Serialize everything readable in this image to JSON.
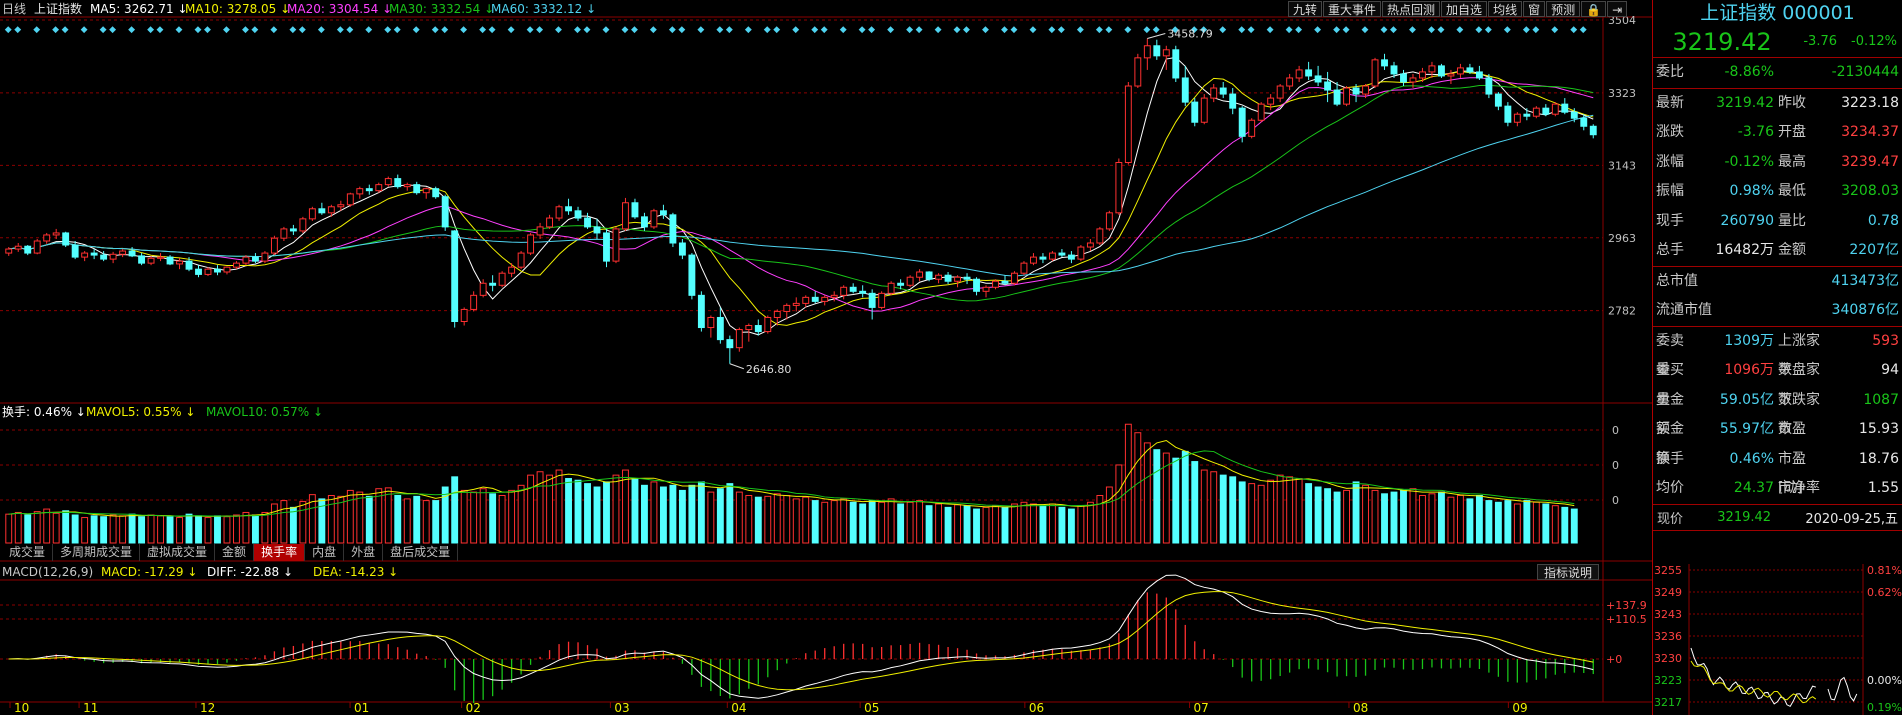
{
  "chart_data": {
    "type": "candlestick",
    "title": "上证指数",
    "period": "日线",
    "price_axis": {
      "min": 2560,
      "max": 3504,
      "ticks": [
        "3504",
        "3323",
        "3143",
        "2963",
        "2782"
      ]
    },
    "month_labels": [
      "10",
      "11",
      "12",
      "01",
      "02",
      "03",
      "04",
      "05",
      "06",
      "07",
      "08",
      "09"
    ],
    "candles": [
      [
        2925,
        2940,
        2918,
        2935
      ],
      [
        2935,
        2950,
        2928,
        2942
      ],
      [
        2942,
        2945,
        2920,
        2925
      ],
      [
        2925,
        2960,
        2922,
        2955
      ],
      [
        2955,
        2975,
        2948,
        2970
      ],
      [
        2970,
        2985,
        2960,
        2975
      ],
      [
        2975,
        2978,
        2940,
        2945
      ],
      [
        2945,
        2955,
        2910,
        2915
      ],
      [
        2915,
        2930,
        2905,
        2925
      ],
      [
        2925,
        2935,
        2910,
        2920
      ],
      [
        2920,
        2930,
        2905,
        2910
      ],
      [
        2910,
        2928,
        2900,
        2922
      ],
      [
        2922,
        2935,
        2915,
        2930
      ],
      [
        2930,
        2940,
        2915,
        2918
      ],
      [
        2918,
        2925,
        2895,
        2900
      ],
      [
        2900,
        2918,
        2895,
        2912
      ],
      [
        2912,
        2925,
        2905,
        2915
      ],
      [
        2915,
        2920,
        2895,
        2898
      ],
      [
        2898,
        2912,
        2885,
        2905
      ],
      [
        2905,
        2915,
        2880,
        2885
      ],
      [
        2885,
        2895,
        2865,
        2872
      ],
      [
        2872,
        2890,
        2868,
        2885
      ],
      [
        2885,
        2895,
        2870,
        2878
      ],
      [
        2878,
        2892,
        2872,
        2890
      ],
      [
        2890,
        2905,
        2885,
        2900
      ],
      [
        2900,
        2920,
        2895,
        2915
      ],
      [
        2915,
        2925,
        2900,
        2905
      ],
      [
        2905,
        2930,
        2900,
        2925
      ],
      [
        2925,
        2968,
        2920,
        2962
      ],
      [
        2962,
        2990,
        2955,
        2985
      ],
      [
        2985,
        2995,
        2970,
        2980
      ],
      [
        2980,
        3015,
        2975,
        3010
      ],
      [
        3010,
        3040,
        3005,
        3035
      ],
      [
        3035,
        3050,
        3020,
        3025
      ],
      [
        3025,
        3045,
        3015,
        3040
      ],
      [
        3040,
        3055,
        3030,
        3045
      ],
      [
        3045,
        3075,
        3040,
        3072
      ],
      [
        3072,
        3090,
        3060,
        3085
      ],
      [
        3085,
        3095,
        3070,
        3080
      ],
      [
        3080,
        3100,
        3075,
        3095
      ],
      [
        3095,
        3115,
        3090,
        3110
      ],
      [
        3110,
        3120,
        3085,
        3090
      ],
      [
        3090,
        3100,
        3080,
        3095
      ],
      [
        3095,
        3102,
        3070,
        3075
      ],
      [
        3075,
        3088,
        3060,
        3085
      ],
      [
        3085,
        3090,
        3060,
        3065
      ],
      [
        3065,
        3070,
        2980,
        2990
      ],
      [
        2980,
        2982,
        2740,
        2755
      ],
      [
        2755,
        2790,
        2745,
        2785
      ],
      [
        2785,
        2830,
        2780,
        2820
      ],
      [
        2820,
        2860,
        2815,
        2850
      ],
      [
        2850,
        2870,
        2830,
        2845
      ],
      [
        2845,
        2880,
        2840,
        2875
      ],
      [
        2875,
        2900,
        2865,
        2890
      ],
      [
        2890,
        2930,
        2885,
        2925
      ],
      [
        2925,
        2975,
        2920,
        2970
      ],
      [
        2970,
        3000,
        2960,
        2990
      ],
      [
        2990,
        3020,
        2985,
        3012
      ],
      [
        3012,
        3045,
        3005,
        3040
      ],
      [
        3040,
        3060,
        3020,
        3030
      ],
      [
        3030,
        3040,
        3005,
        3012
      ],
      [
        3012,
        3025,
        2985,
        2990
      ],
      [
        2990,
        3010,
        2960,
        2975
      ],
      [
        2975,
        2985,
        2890,
        2905
      ],
      [
        2905,
        2990,
        2900,
        2985
      ],
      [
        2985,
        3062,
        2980,
        3050
      ],
      [
        3050,
        3060,
        3010,
        3015
      ],
      [
        3015,
        3025,
        2980,
        2990
      ],
      [
        2990,
        3035,
        2985,
        3030
      ],
      [
        3030,
        3045,
        3010,
        3020
      ],
      [
        3020,
        3025,
        2940,
        2950
      ],
      [
        2950,
        2960,
        2910,
        2920
      ],
      [
        2920,
        2925,
        2810,
        2820
      ],
      [
        2820,
        2830,
        2730,
        2740
      ],
      [
        2740,
        2770,
        2715,
        2765
      ],
      [
        2765,
        2790,
        2700,
        2710
      ],
      [
        2710,
        2720,
        2650,
        2690
      ],
      [
        2690,
        2740,
        2680,
        2735
      ],
      [
        2735,
        2750,
        2705,
        2745
      ],
      [
        2745,
        2760,
        2720,
        2730
      ],
      [
        2730,
        2770,
        2725,
        2765
      ],
      [
        2765,
        2785,
        2745,
        2780
      ],
      [
        2780,
        2800,
        2760,
        2795
      ],
      [
        2795,
        2815,
        2780,
        2800
      ],
      [
        2800,
        2820,
        2790,
        2815
      ],
      [
        2815,
        2830,
        2800,
        2805
      ],
      [
        2805,
        2820,
        2795,
        2815
      ],
      [
        2815,
        2830,
        2805,
        2820
      ],
      [
        2820,
        2845,
        2810,
        2840
      ],
      [
        2840,
        2850,
        2825,
        2830
      ],
      [
        2830,
        2845,
        2815,
        2825
      ],
      [
        2825,
        2835,
        2760,
        2790
      ],
      [
        2790,
        2830,
        2785,
        2825
      ],
      [
        2825,
        2855,
        2820,
        2850
      ],
      [
        2850,
        2860,
        2835,
        2845
      ],
      [
        2845,
        2870,
        2840,
        2865
      ],
      [
        2865,
        2885,
        2855,
        2878
      ],
      [
        2878,
        2880,
        2855,
        2860
      ],
      [
        2860,
        2875,
        2850,
        2870
      ],
      [
        2870,
        2878,
        2848,
        2855
      ],
      [
        2855,
        2870,
        2840,
        2865
      ],
      [
        2865,
        2875,
        2848,
        2860
      ],
      [
        2860,
        2865,
        2820,
        2830
      ],
      [
        2830,
        2845,
        2815,
        2840
      ],
      [
        2840,
        2860,
        2835,
        2855
      ],
      [
        2855,
        2870,
        2845,
        2850
      ],
      [
        2850,
        2880,
        2845,
        2875
      ],
      [
        2875,
        2905,
        2870,
        2900
      ],
      [
        2900,
        2925,
        2895,
        2915
      ],
      [
        2915,
        2925,
        2900,
        2910
      ],
      [
        2910,
        2930,
        2905,
        2925
      ],
      [
        2925,
        2935,
        2915,
        2920
      ],
      [
        2920,
        2930,
        2900,
        2910
      ],
      [
        2910,
        2945,
        2905,
        2940
      ],
      [
        2940,
        2960,
        2930,
        2950
      ],
      [
        2950,
        2990,
        2945,
        2985
      ],
      [
        2985,
        3030,
        2980,
        3025
      ],
      [
        3025,
        3160,
        3020,
        3150
      ],
      [
        3150,
        3350,
        3145,
        3340
      ],
      [
        3340,
        3420,
        3335,
        3410
      ],
      [
        3410,
        3458,
        3380,
        3440
      ],
      [
        3440,
        3455,
        3405,
        3415
      ],
      [
        3415,
        3440,
        3380,
        3430
      ],
      [
        3430,
        3440,
        3350,
        3360
      ],
      [
        3360,
        3390,
        3290,
        3300
      ],
      [
        3300,
        3310,
        3240,
        3250
      ],
      [
        3250,
        3320,
        3245,
        3310
      ],
      [
        3310,
        3345,
        3300,
        3335
      ],
      [
        3335,
        3350,
        3310,
        3320
      ],
      [
        3320,
        3335,
        3270,
        3285
      ],
      [
        3285,
        3290,
        3200,
        3215
      ],
      [
        3215,
        3260,
        3210,
        3255
      ],
      [
        3255,
        3300,
        3250,
        3295
      ],
      [
        3295,
        3320,
        3280,
        3310
      ],
      [
        3310,
        3345,
        3300,
        3340
      ],
      [
        3340,
        3370,
        3330,
        3360
      ],
      [
        3360,
        3390,
        3350,
        3380
      ],
      [
        3380,
        3400,
        3355,
        3365
      ],
      [
        3365,
        3390,
        3340,
        3350
      ],
      [
        3350,
        3375,
        3300,
        3330
      ],
      [
        3330,
        3350,
        3290,
        3295
      ],
      [
        3295,
        3340,
        3290,
        3335
      ],
      [
        3335,
        3345,
        3300,
        3320
      ],
      [
        3320,
        3345,
        3310,
        3340
      ],
      [
        3340,
        3410,
        3335,
        3405
      ],
      [
        3405,
        3420,
        3380,
        3390
      ],
      [
        3390,
        3400,
        3360,
        3370
      ],
      [
        3370,
        3380,
        3340,
        3350
      ],
      [
        3350,
        3370,
        3335,
        3360
      ],
      [
        3360,
        3385,
        3350,
        3375
      ],
      [
        3375,
        3400,
        3360,
        3390
      ],
      [
        3390,
        3395,
        3360,
        3365
      ],
      [
        3365,
        3380,
        3345,
        3370
      ],
      [
        3370,
        3395,
        3360,
        3385
      ],
      [
        3385,
        3395,
        3370,
        3375
      ],
      [
        3375,
        3390,
        3355,
        3360
      ],
      [
        3360,
        3370,
        3310,
        3320
      ],
      [
        3320,
        3325,
        3280,
        3290
      ],
      [
        3290,
        3300,
        3240,
        3250
      ],
      [
        3250,
        3275,
        3240,
        3270
      ],
      [
        3270,
        3285,
        3255,
        3265
      ],
      [
        3265,
        3290,
        3260,
        3285
      ],
      [
        3285,
        3295,
        3265,
        3270
      ],
      [
        3270,
        3300,
        3265,
        3295
      ],
      [
        3295,
        3310,
        3270,
        3275
      ],
      [
        3275,
        3285,
        3250,
        3260
      ],
      [
        3260,
        3270,
        3230,
        3240
      ],
      [
        3240,
        3245,
        3210,
        3219
      ]
    ],
    "ma": [
      {
        "name": "MA5",
        "value": "3262.71",
        "color": "#ffffff"
      },
      {
        "name": "MA10",
        "value": "3278.05",
        "color": "#f0f000"
      },
      {
        "name": "MA20",
        "value": "3304.54",
        "color": "#ff40ff"
      },
      {
        "name": "MA30",
        "value": "3332.54",
        "color": "#19c419"
      },
      {
        "name": "MA60",
        "value": "3332.12",
        "color": "#4fd3f0"
      }
    ],
    "max_label": "3458.79",
    "min_label": "2646.80",
    "volume_header": [
      {
        "name": "换手",
        "value": "0.46%",
        "color": "#ffffff"
      },
      {
        "name": "MAVOL5",
        "value": "0.55%",
        "color": "#f0f000"
      },
      {
        "name": "MAVOL10",
        "value": "0.57%",
        "color": "#19c419"
      }
    ],
    "volume_ticks": [
      "0",
      "0",
      "0"
    ],
    "volume": [
      0.34,
      0.36,
      0.33,
      0.37,
      0.4,
      0.35,
      0.38,
      0.33,
      0.3,
      0.32,
      0.31,
      0.33,
      0.32,
      0.34,
      0.31,
      0.33,
      0.32,
      0.31,
      0.3,
      0.34,
      0.32,
      0.3,
      0.32,
      0.31,
      0.33,
      0.36,
      0.33,
      0.36,
      0.46,
      0.5,
      0.42,
      0.49,
      0.57,
      0.52,
      0.56,
      0.55,
      0.62,
      0.6,
      0.55,
      0.64,
      0.65,
      0.56,
      0.52,
      0.55,
      0.5,
      0.5,
      0.66,
      0.78,
      0.62,
      0.6,
      0.64,
      0.58,
      0.56,
      0.62,
      0.68,
      0.8,
      0.84,
      0.8,
      0.86,
      0.76,
      0.74,
      0.7,
      0.66,
      0.72,
      0.8,
      0.86,
      0.76,
      0.68,
      0.72,
      0.66,
      0.68,
      0.62,
      0.68,
      0.72,
      0.6,
      0.64,
      0.7,
      0.6,
      0.56,
      0.54,
      0.55,
      0.58,
      0.56,
      0.52,
      0.54,
      0.5,
      0.48,
      0.5,
      0.52,
      0.48,
      0.46,
      0.5,
      0.48,
      0.52,
      0.46,
      0.48,
      0.5,
      0.44,
      0.46,
      0.42,
      0.45,
      0.44,
      0.4,
      0.42,
      0.44,
      0.42,
      0.46,
      0.48,
      0.46,
      0.44,
      0.46,
      0.42,
      0.4,
      0.44,
      0.48,
      0.56,
      0.66,
      0.92,
      1.4,
      1.3,
      1.18,
      1.1,
      1.06,
      1.0,
      1.08,
      0.96,
      0.86,
      0.84,
      0.8,
      0.78,
      0.72,
      0.7,
      0.68,
      0.74,
      0.8,
      0.78,
      0.76,
      0.7,
      0.66,
      0.64,
      0.6,
      0.62,
      0.72,
      0.68,
      0.62,
      0.58,
      0.6,
      0.62,
      0.64,
      0.56,
      0.58,
      0.6,
      0.54,
      0.56,
      0.52,
      0.56,
      0.5,
      0.48,
      0.5,
      0.46,
      0.5,
      0.48,
      0.46,
      0.44,
      0.42,
      0.4
    ],
    "macd_header": [
      {
        "name": "MACD(12,26,9)",
        "value": "",
        "color": "#c8c8c8"
      },
      {
        "name": "MACD",
        "value": "-17.29",
        "color": "#f0f000"
      },
      {
        "name": "DIFF",
        "value": "-22.88",
        "color": "#ffffff"
      },
      {
        "name": "DEA",
        "value": "-14.23",
        "color": "#f0f000"
      }
    ],
    "macd_ticks": [
      "+137.9",
      "+110.5",
      "+0"
    ]
  },
  "volume_tabs": [
    "成交量",
    "多周期成交量",
    "虚拟成交量",
    "金额",
    "换手率",
    "内盘",
    "外盘",
    "盘后成交量"
  ],
  "volume_tab_active": 4,
  "toolbar": [
    "九转",
    "重大事件",
    "热点回测",
    "加自选",
    "均线",
    "窗",
    "预测",
    "🔒",
    "⇥"
  ],
  "indicator_button": "指标说明",
  "side": {
    "title": "上证指数 000001",
    "price": "3219.42",
    "change": "-3.76",
    "pct": "-0.12%",
    "weibi": {
      "label": "委比",
      "pct": "-8.86%",
      "num": "-2130444"
    },
    "g1": [
      [
        "最新",
        "3219.42",
        "g",
        "昨收",
        "3223.18",
        "w"
      ],
      [
        "涨跌",
        "-3.76",
        "g",
        "开盘",
        "3234.37",
        "r"
      ],
      [
        "涨幅",
        "-0.12%",
        "g",
        "最高",
        "3239.47",
        "r"
      ],
      [
        "振幅",
        "0.98%",
        "c",
        "最低",
        "3208.03",
        "g"
      ],
      [
        "现手",
        "260790",
        "c",
        "量比",
        "0.78",
        "c"
      ],
      [
        "总手",
        "16482万",
        "w",
        "金额",
        "2207亿",
        "c"
      ]
    ],
    "g2": [
      [
        "总市值",
        "413473亿",
        "c"
      ],
      [
        "流通市值",
        "340876亿",
        "c"
      ]
    ],
    "g3": [
      [
        "委卖量",
        "1309万",
        "c",
        "上涨家数",
        "593",
        "r"
      ],
      [
        "委买量",
        "1096万",
        "r",
        "平盘家数",
        "94",
        "w"
      ],
      [
        "卖金额",
        "59.05亿",
        "c",
        "下跌家数",
        "1087",
        "g"
      ],
      [
        "买金额",
        "55.97亿",
        "c",
        "市盈",
        "15.93",
        "w"
      ],
      [
        "换手",
        "0.46%",
        "c",
        "市盈[动]",
        "18.76",
        "w"
      ],
      [
        "均价",
        "24.37",
        "g",
        "市净率",
        "1.55",
        "w"
      ]
    ],
    "now": {
      "label": "现价",
      "price": "3219.42",
      "date": "2020-09-25,五"
    },
    "mini_ticks": [
      "3255",
      "3249",
      "3243",
      "3236",
      "3230",
      "3223",
      "3217"
    ],
    "mini_pct": [
      "0.81%",
      "0.62%",
      "0.00%",
      "0.19%"
    ]
  },
  "colors": {
    "up": "#ff3030",
    "down": "#54ffff",
    "grid": "#8b0000"
  }
}
